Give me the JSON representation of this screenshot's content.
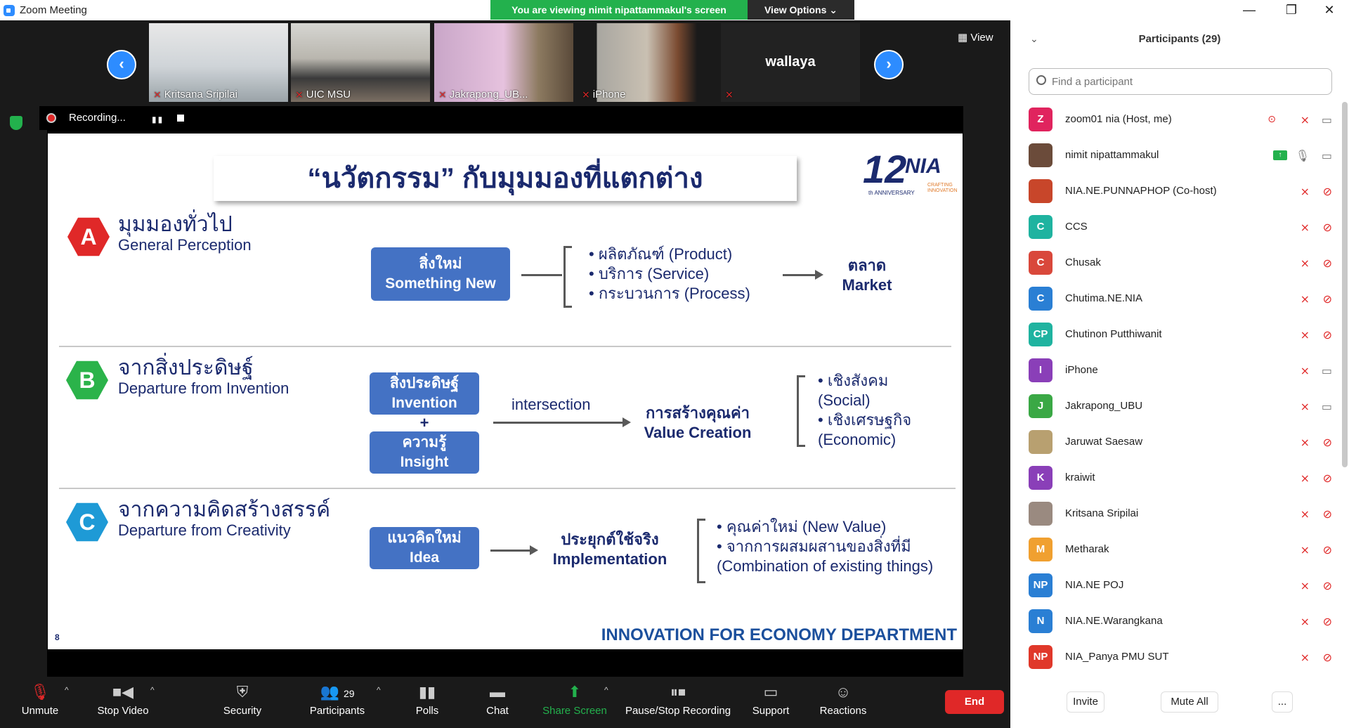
{
  "window": {
    "title": "Zoom Meeting",
    "viewing_banner": "You are viewing nimit nipattammakul's screen",
    "view_options": "View Options ⌄",
    "minimize": "—",
    "restore": "❐",
    "close": "✕"
  },
  "thumbnails": [
    {
      "name": "Kritsana Sripilai"
    },
    {
      "name": "UIC MSU"
    },
    {
      "name": "Jakrapong_UB..."
    },
    {
      "name": "iPhone"
    },
    {
      "name": "wallaya",
      "label": "wallaya"
    }
  ],
  "view_button": "View",
  "recording": {
    "label": "Recording..."
  },
  "slide": {
    "title": "“นวัตกรรม” กับมุมมองที่แตกต่าง",
    "logo_number": "12",
    "logo_brand": "NIA",
    "logo_anniv": "th ANNIVERSARY",
    "logo_tag1": "CRAFTING",
    "logo_tag2": "INNOVATION",
    "sections": [
      {
        "letter": "A",
        "color": "#e02828",
        "th": "มุมมองทั่วไป",
        "en": "General Perception"
      },
      {
        "letter": "B",
        "color": "#2bb34a",
        "th": "จากสิ่งประดิษฐ์",
        "en": "Departure from Invention"
      },
      {
        "letter": "C",
        "color": "#1e9ad6",
        "th": "จากความคิดสร้างสรรค์",
        "en": "Departure from Creativity"
      }
    ],
    "a": {
      "box_th": "สิ่งใหม่",
      "box_en": "Something New",
      "bullets": [
        "•  ผลิตภัณฑ์ (Product)",
        "•  บริการ (Service)",
        "•  กระบวนการ (Process)"
      ],
      "result_th": "ตลาด",
      "result_en": "Market"
    },
    "b": {
      "box1_th": "สิ่งประดิษฐ์",
      "box1_en": "Invention",
      "plus": "+",
      "box2_th": "ความรู้",
      "box2_en": "Insight",
      "arrow_label": "intersection",
      "result_th": "การสร้างคุณค่า",
      "result_en": "Value Creation",
      "bullets": [
        "•  เชิงสังคม",
        "    (Social)",
        "•  เชิงเศรษฐกิจ",
        "    (Economic)"
      ]
    },
    "c": {
      "box_th": "แนวคิดใหม่",
      "box_en": "Idea",
      "result_th": "ประยุกต์ใช้จริง",
      "result_en": "Implementation",
      "bullets": [
        "•  คุณค่าใหม่ (New Value)",
        "•  จากการผสมผสานของสิ่งที่มี",
        "    (Combination of existing things)"
      ]
    },
    "page": "8",
    "footer": "INNOVATION FOR ECONOMY DEPARTMENT"
  },
  "toolbar": {
    "unmute": "Unmute",
    "stop_video": "Stop Video",
    "security": "Security",
    "participants": "Participants",
    "participants_count": "29",
    "polls": "Polls",
    "chat": "Chat",
    "share_screen": "Share Screen",
    "pause_recording": "Pause/Stop Recording",
    "support": "Support",
    "reactions": "Reactions",
    "end": "End"
  },
  "panel": {
    "title": "Participants (29)",
    "search_placeholder": "Find a participant",
    "participants": [
      {
        "initials": "Z",
        "color": "#e0245e",
        "name": "zoom01 nia (Host, me)"
      },
      {
        "initials": "",
        "color": "#6b4b3a",
        "name": "nimit nipattammakul"
      },
      {
        "initials": "",
        "color": "#c8462a",
        "name": "NIA.NE.PUNNAPHOP (Co-host)"
      },
      {
        "initials": "C",
        "color": "#1fb3a0",
        "name": "CCS"
      },
      {
        "initials": "C",
        "color": "#d9483b",
        "name": "Chusak"
      },
      {
        "initials": "C",
        "color": "#2a7fd4",
        "name": "Chutima.NE.NIA"
      },
      {
        "initials": "CP",
        "color": "#1fb3a0",
        "name": "Chutinon Putthiwanit"
      },
      {
        "initials": "I",
        "color": "#8a3fb8",
        "name": "iPhone"
      },
      {
        "initials": "J",
        "color": "#3aa845",
        "name": "Jakrapong_UBU"
      },
      {
        "initials": "",
        "color": "#b8a070",
        "name": "Jaruwat Saesaw"
      },
      {
        "initials": "K",
        "color": "#8a3fb8",
        "name": "kraiwit"
      },
      {
        "initials": "",
        "color": "#9a8a80",
        "name": "Kritsana Sripilai"
      },
      {
        "initials": "M",
        "color": "#f0a030",
        "name": "Metharak"
      },
      {
        "initials": "NP",
        "color": "#2a7fd4",
        "name": "NIA.NE POJ"
      },
      {
        "initials": "N",
        "color": "#2a7fd4",
        "name": "NIA.NE.Warangkana"
      },
      {
        "initials": "NP",
        "color": "#e0382a",
        "name": "NIA_Panya PMU SUT"
      }
    ],
    "invite": "Invite",
    "mute_all": "Mute All",
    "more": "..."
  }
}
